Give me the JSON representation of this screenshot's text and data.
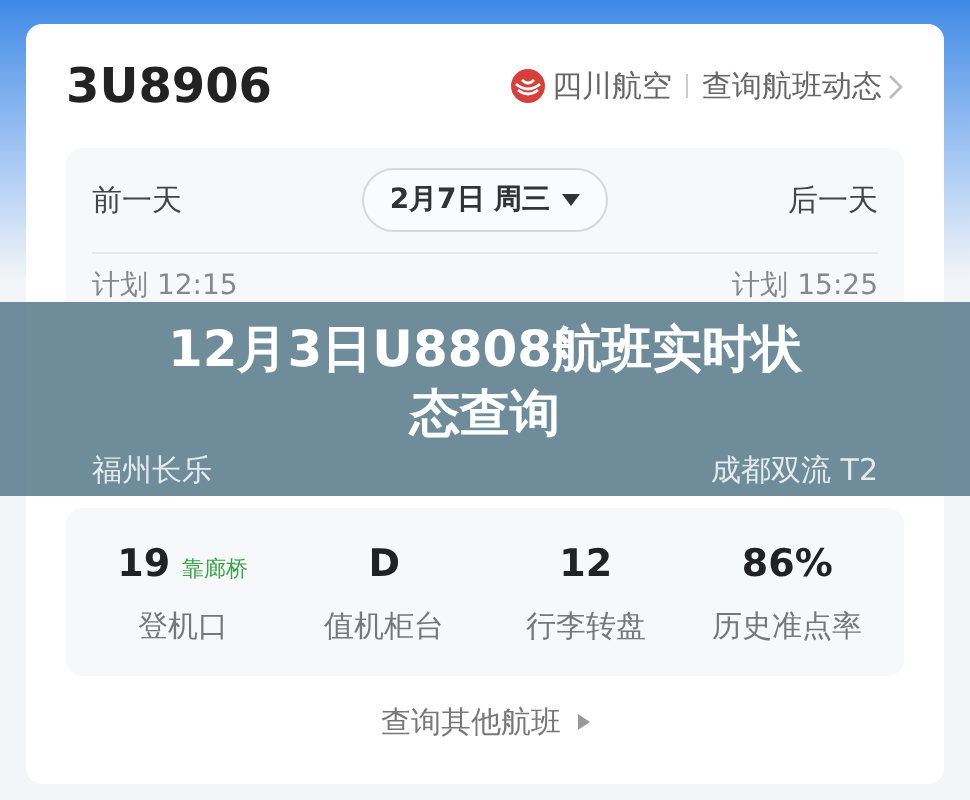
{
  "flight": {
    "number": "3U8906",
    "airline": "四川航空",
    "status_link": "查询航班动态"
  },
  "date_bar": {
    "prev": "前一天",
    "date": "2月7日 周三",
    "next": "后一天"
  },
  "schedule": {
    "departure": {
      "plan": "计划 12:15",
      "airport": "福州长乐"
    },
    "arrival": {
      "plan": "计划 15:25",
      "airport": "成都双流 T2"
    }
  },
  "stats": [
    {
      "value": "19",
      "tag": "靠廊桥",
      "label": "登机口"
    },
    {
      "value": "D",
      "label": "值机柜台"
    },
    {
      "value": "12",
      "label": "行李转盘"
    },
    {
      "value": "86%",
      "label": "历史准点率"
    }
  ],
  "more_link": "查询其他航班",
  "banner": {
    "title": "12月3日U8808航班实时状态查询"
  }
}
